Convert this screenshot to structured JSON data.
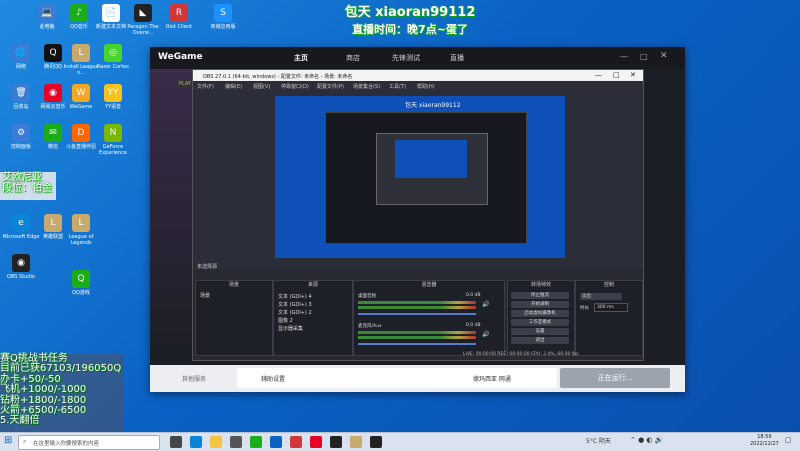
{
  "banner": {
    "line1": "包天 xiaoran99112",
    "line2": "直播时间：晚7点~蛋了"
  },
  "desktop_icons": [
    {
      "label": "此电脑",
      "color": "#3a7bd5",
      "glyph": "💻"
    },
    {
      "label": "QQ音乐",
      "color": "#1aad19",
      "glyph": "♪"
    },
    {
      "label": "新建文本文档",
      "color": "#ffffff",
      "glyph": "📄"
    },
    {
      "label": "Paragon The Overw...",
      "color": "#222",
      "glyph": "◣"
    },
    {
      "label": "Riot Client",
      "color": "#d13639",
      "glyph": "R"
    },
    {
      "label": "商城应用版",
      "color": "#1e90ff",
      "glyph": "S"
    },
    {
      "label": "网络",
      "color": "#3a7bd5",
      "glyph": "🌐"
    },
    {
      "label": "腾讯QQ",
      "color": "#111",
      "glyph": "Q"
    },
    {
      "label": "Install League o...",
      "color": "#c8aa6e",
      "glyph": "L"
    },
    {
      "label": "Razer Cortex",
      "color": "#44d62c",
      "glyph": "◎"
    },
    {
      "label": "回收站",
      "color": "#3a7bd5",
      "glyph": "🗑"
    },
    {
      "label": "网易云音乐",
      "color": "#e60026",
      "glyph": "◉"
    },
    {
      "label": "WeGame",
      "color": "#f5a623",
      "glyph": "W"
    },
    {
      "label": "YY语音",
      "color": "#f8c21c",
      "glyph": "YY"
    },
    {
      "label": "控制面板",
      "color": "#3a7bd5",
      "glyph": "⚙"
    },
    {
      "label": "微信",
      "color": "#1aad19",
      "glyph": "✉"
    },
    {
      "label": "斗鱼直播伴侣",
      "color": "#f60",
      "glyph": "D"
    },
    {
      "label": "GeForce Experience",
      "color": "#76b900",
      "glyph": "N"
    },
    {
      "label": "Microsoft Edge",
      "color": "#0a84d6",
      "glyph": "e"
    },
    {
      "label": "英雄联盟",
      "color": "#c8aa6e",
      "glyph": "L"
    },
    {
      "label": "League of Legends",
      "color": "#c8aa6e",
      "glyph": "L"
    },
    {
      "label": "OBS Studio",
      "color": "#222",
      "glyph": "◉"
    },
    {
      "label": "QQ游戏",
      "color": "#1aad19",
      "glyph": "Q"
    }
  ],
  "rank_overlay": {
    "line1": "艾欧尼亚",
    "line2": "段位：铂金"
  },
  "overlay": {
    "lines": [
      "赛Q挑战书任务",
      "目前已获67103/196050Q",
      "办卡+50/-50",
      "飞机+1000/-1000",
      "钻粉+1800/-1800",
      "火箭+6500/-6500",
      "5.天翻倍"
    ]
  },
  "wegame": {
    "logo": "WeGame",
    "tabs": [
      "主页",
      "商店",
      "先锋测试",
      "直播"
    ],
    "bottom_left": "其他服务",
    "bottom_mid": "辅助设置",
    "bottom_region": "德玛西亚 网通",
    "status": "正在运行...",
    "play": "PLAY"
  },
  "obs": {
    "title": "OBS 27.0.1 (64-bit, windows) - 配置文件: 未命名 - 场景: 未命名",
    "menu": [
      "文件(F)",
      "编辑(E)",
      "视图(V)",
      "停靠窗口(D)",
      "配置文件(P)",
      "场景集合(S)",
      "工具(T)",
      "帮助(H)"
    ],
    "scene_label": "未选择源",
    "docks": {
      "scenes": "场景",
      "sources": "来源",
      "mixer": "混音器",
      "transitions": "转场特效",
      "controls": "控制"
    },
    "scene_item": "场景",
    "sources": [
      "文本 (GDI+) 4",
      "文本 (GDI+) 3",
      "文本 (GDI+) 2",
      "图像 2",
      "显示器采集"
    ],
    "mixer": [
      {
        "name": "桌面音频",
        "db": "0.0 dB"
      },
      {
        "name": "麦克风/Aux",
        "db": "0.0 dB"
      }
    ],
    "controls": [
      "停止推流",
      "开始录制",
      "启动虚拟摄像机",
      "工作室模式",
      "设置",
      "退出"
    ],
    "transition": "淡出",
    "duration_label": "时长",
    "duration": "300 ms",
    "status": "LIVE: 00:00:00  REC: 00:00:00  CPU: 2.4%, 60.00 fps"
  },
  "taskbar": {
    "search": "在这里输入你要搜索的内容",
    "weather": "5°C 阴天",
    "time": "18:59",
    "date": "2022/12/27"
  }
}
